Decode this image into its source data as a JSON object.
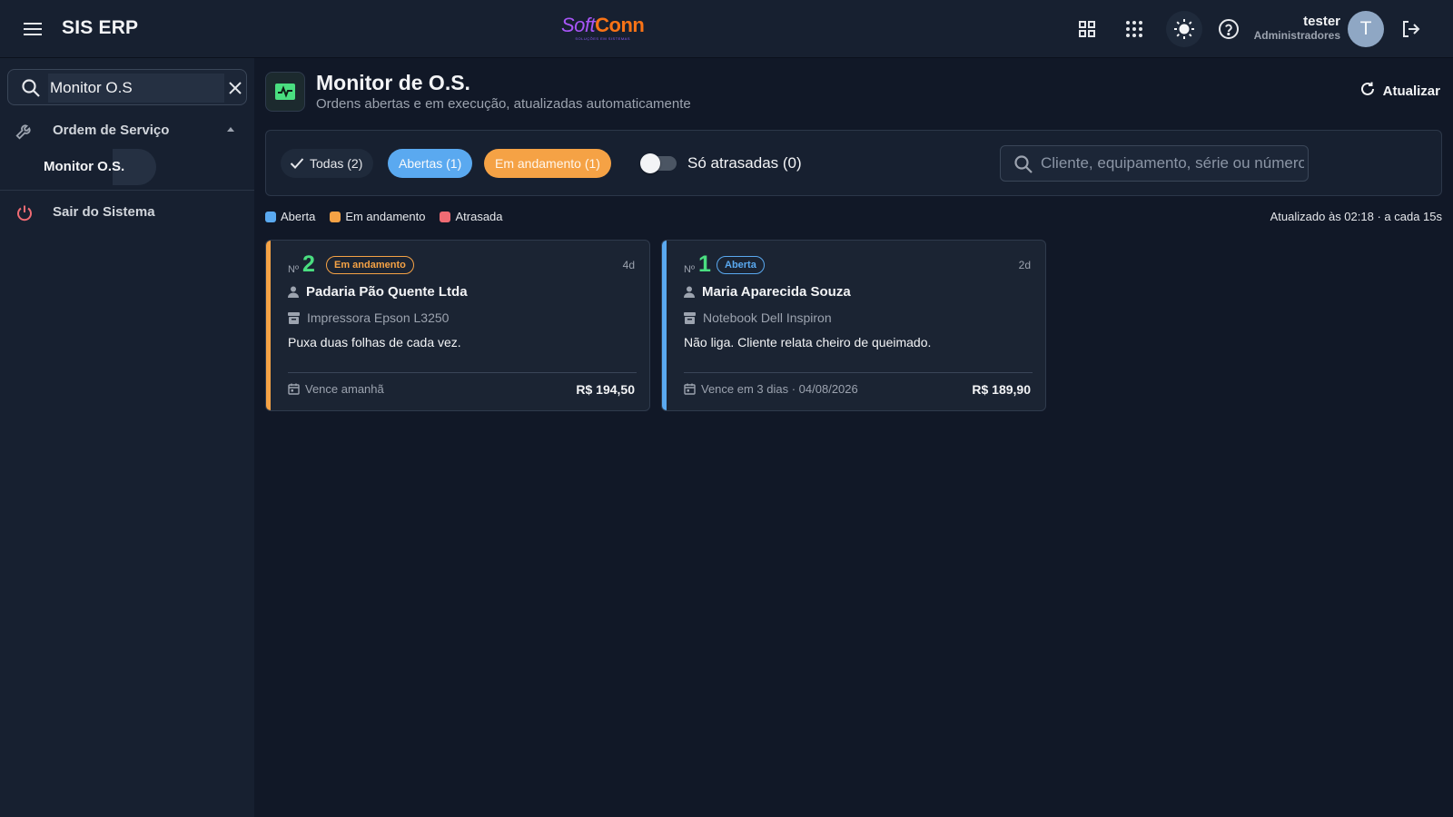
{
  "header": {
    "app_title": "SIS ERP",
    "logo_soft": "Soft",
    "logo_conn": "Conn",
    "logo_tagline": "SOLUÇÕES EM SISTEMAS",
    "user_name": "tester",
    "user_role": "Administradores",
    "avatar_initial": "T"
  },
  "sidebar": {
    "search_value": "Monitor O.S",
    "group_label": "Ordem de Serviço",
    "sub_item_label": "Monitor O.S.",
    "exit_label": "Sair do Sistema"
  },
  "page": {
    "title": "Monitor de O.S.",
    "subtitle": "Ordens abertas e em execução, atualizadas automaticamente",
    "refresh_label": "Atualizar"
  },
  "filters": {
    "all_label": "Todas (2)",
    "open_label": "Abertas (1)",
    "in_progress_label": "Em andamento (1)",
    "late_only_label": "Só atrasadas (0)",
    "late_only_on": false,
    "search_placeholder": "Cliente, equipamento, série ou número"
  },
  "legend": [
    {
      "label": "Aberta",
      "color": "#5aa9f0"
    },
    {
      "label": "Em andamento",
      "color": "#f5a245"
    },
    {
      "label": "Atrasada",
      "color": "#ef6b73"
    }
  ],
  "updated_text": "Atualizado às 02:18 · a cada 15s",
  "cards": [
    {
      "no_label": "Nº",
      "number": "2",
      "status": "Em andamento",
      "age": "4d",
      "client": "Padaria Pão Quente Ltda",
      "equipment": "Impressora Epson L3250",
      "description": "Puxa duas folhas de cada vez.",
      "due": "Vence amanhã",
      "price": "R$ 194,50"
    },
    {
      "no_label": "Nº",
      "number": "1",
      "status": "Aberta",
      "age": "2d",
      "client": "Maria Aparecida Souza",
      "equipment": "Notebook Dell Inspiron",
      "description": "Não liga. Cliente relata cheiro de queimado.",
      "due": "Vence em 3 dias · 04/08/2026",
      "price": "R$ 189,90"
    }
  ],
  "colors": {
    "open": "#5aa9f0",
    "in_progress": "#f5a245",
    "late": "#ef6b73",
    "number": "#4ade80"
  },
  "icons": {
    "menu": "menu-icon",
    "dashboard": "dashboard-icon",
    "apps": "apps-grid-icon",
    "theme": "sun-icon",
    "help": "help-icon",
    "logout": "logout-icon",
    "search": "search-icon",
    "close": "close-icon",
    "wrench": "wrench-icon",
    "power": "power-icon",
    "monitor": "monitor-pulse-icon",
    "refresh": "refresh-icon",
    "check": "check-icon",
    "person": "person-icon",
    "device": "device-icon",
    "calendar": "calendar-icon"
  }
}
